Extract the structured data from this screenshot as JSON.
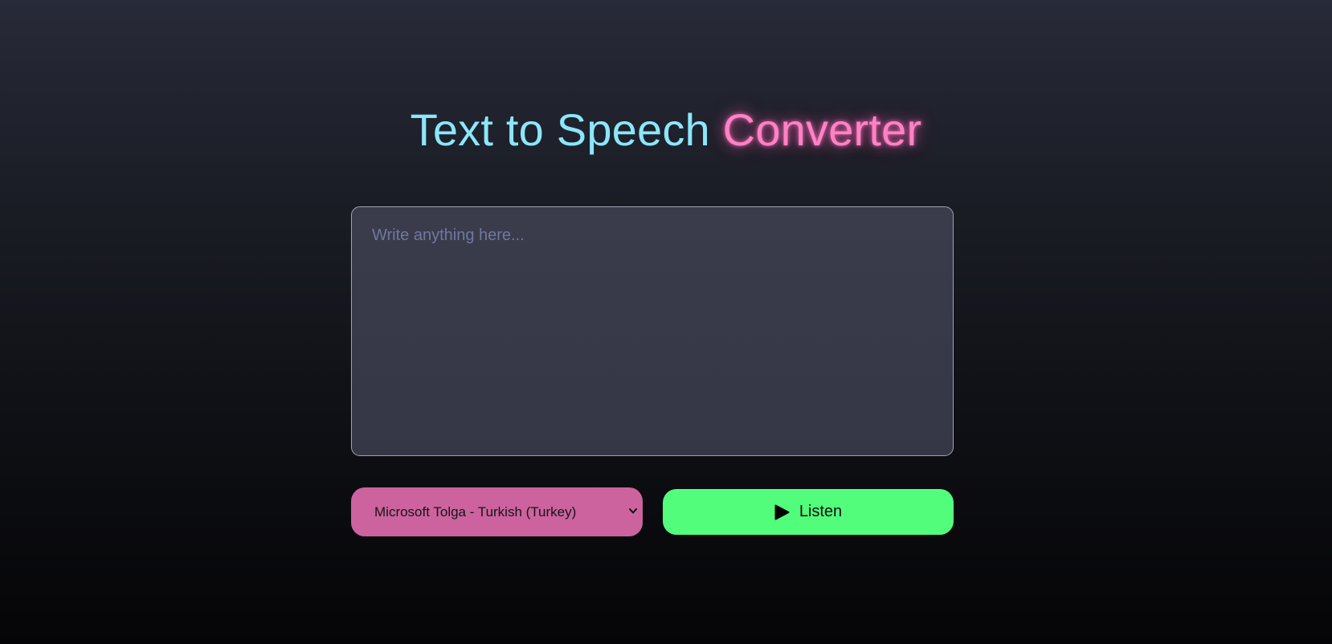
{
  "title": {
    "part1": "Text to Speech",
    "part2": "Converter"
  },
  "textbox": {
    "placeholder": "Write anything here...",
    "value": ""
  },
  "voice_select": {
    "selected": "Microsoft Tolga - Turkish (Turkey)",
    "options": [
      "Microsoft Tolga - Turkish (Turkey)"
    ]
  },
  "listen_button": {
    "label": "Listen",
    "icon": "play-icon"
  },
  "colors": {
    "title_primary": "#8ce6fa",
    "title_accent": "#ff82c4",
    "select_bg": "#cc639f",
    "button_bg": "#52fd7c",
    "textarea_bg": "#373948"
  }
}
